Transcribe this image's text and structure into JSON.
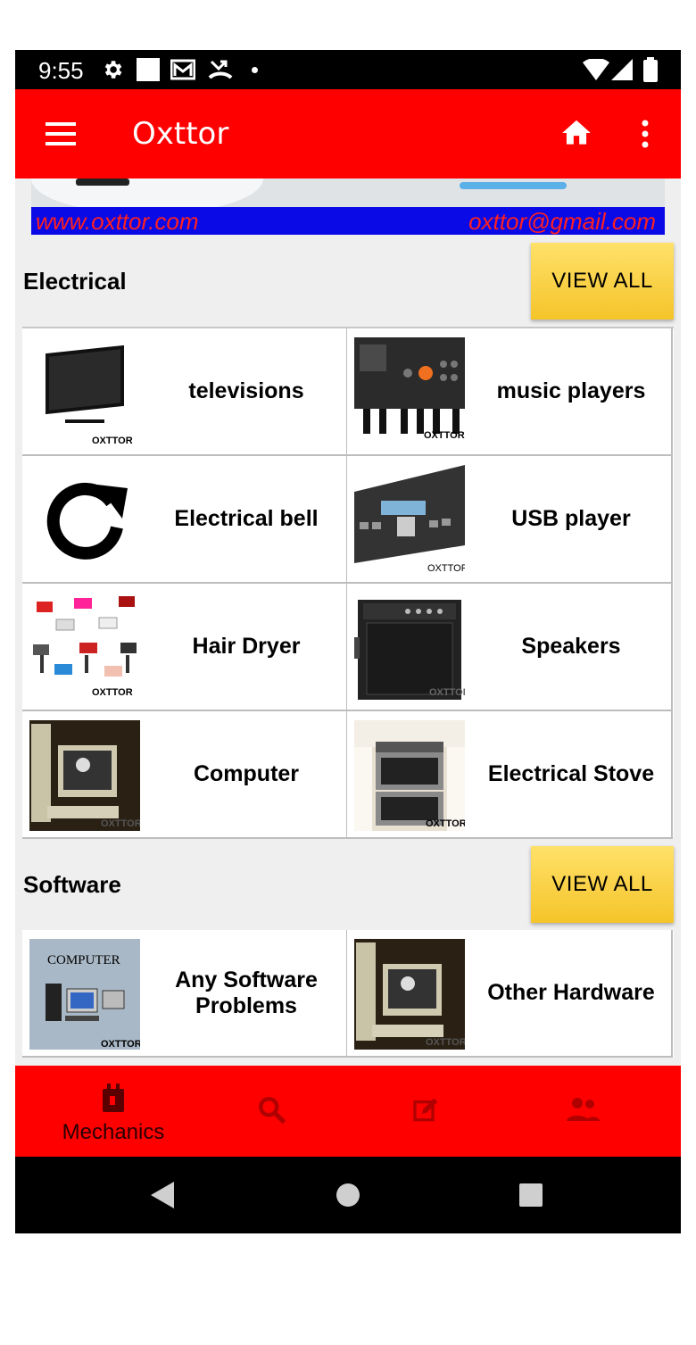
{
  "status_bar": {
    "time": "9:55"
  },
  "app_bar": {
    "title": "Oxttor"
  },
  "banner": {
    "website": "www.oxttor.com",
    "email": "oxttor@gmail.com"
  },
  "sections": [
    {
      "title": "Electrical",
      "view_all_label": "VIEW ALL",
      "items": [
        {
          "label": "televisions",
          "watermark": "OXTTOR"
        },
        {
          "label": "music players",
          "watermark": "OXTTOR"
        },
        {
          "label": "Electrical bell"
        },
        {
          "label": "USB player",
          "watermark": "OXTTOR"
        },
        {
          "label": "Hair Dryer",
          "watermark": "OXTTOR"
        },
        {
          "label": "Speakers",
          "watermark": "OXTTOR"
        },
        {
          "label": "Computer",
          "watermark": "OXTTOR"
        },
        {
          "label": "Electrical Stove",
          "watermark": "OXTTOR"
        }
      ]
    },
    {
      "title": "Software",
      "view_all_label": "VIEW ALL",
      "items": [
        {
          "label": "Any Software Problems",
          "watermark": "OXTTOR",
          "thumb_text": "COMPUTER"
        },
        {
          "label": "Other Hardware",
          "watermark": "OXTTOR"
        }
      ]
    }
  ],
  "bottom_nav": {
    "items": [
      {
        "label": "Mechanics",
        "icon": "mechanics-icon",
        "active": true
      },
      {
        "icon": "search-icon"
      },
      {
        "icon": "edit-icon"
      },
      {
        "icon": "people-icon"
      }
    ]
  },
  "colors": {
    "primary": "#ff0000",
    "accent": "#f5c42a",
    "active_nav": "#3a0000",
    "inactive_nav": "#b00000"
  }
}
